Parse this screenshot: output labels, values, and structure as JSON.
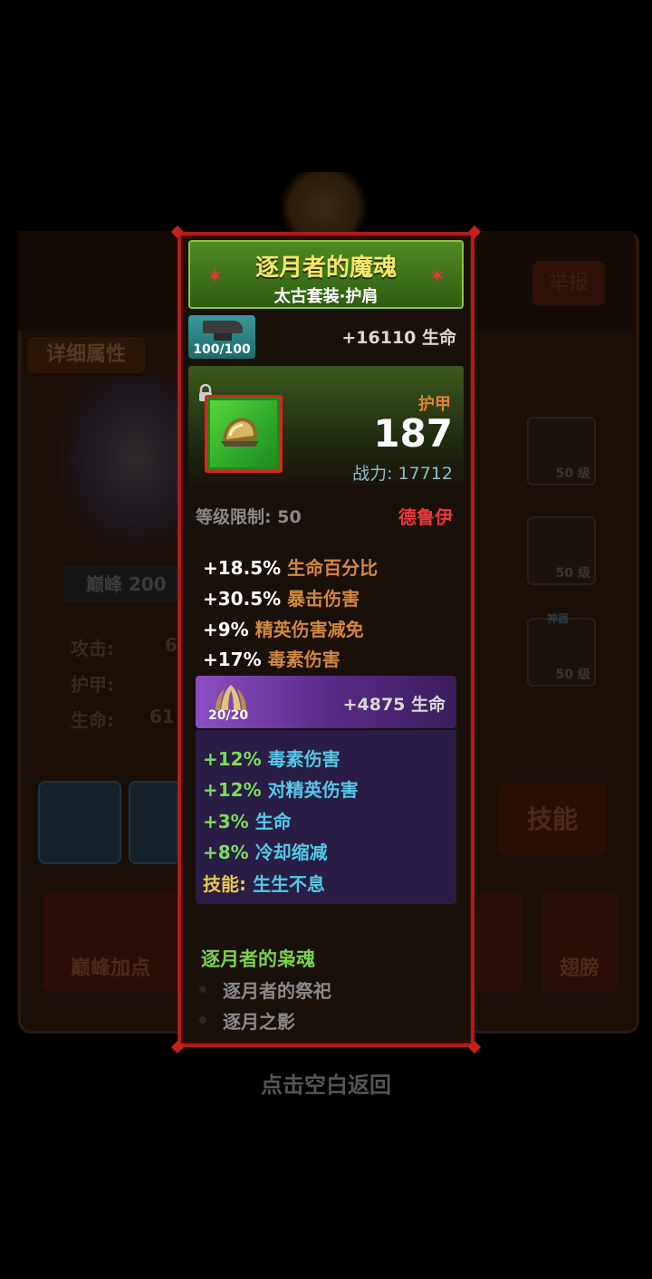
{
  "background": {
    "detail_tab": "详细属性",
    "peak_badge": "巅峰 200",
    "stat_labels": [
      "攻击:",
      "护甲:",
      "生命:"
    ],
    "stat_values": [
      "6",
      "",
      "61"
    ],
    "slot_level": "50 级",
    "slot_tag": "神器",
    "skill_button": "技能",
    "peak_points_button": "巅峰加点",
    "wings_button": "翅膀",
    "top_right_button": "举报"
  },
  "tap_hint": "点击空白返回",
  "item": {
    "name": "逐月者的魔魂",
    "set_slot": "太古套装·护肩",
    "forge_count": "100/100",
    "forge_bonus": "+16110 生命",
    "armor_label": "护甲",
    "armor_value": "187",
    "power_label": "战力:",
    "power_value": "17712",
    "level_label": "等级限制:",
    "level_value": "50",
    "class": "德鲁伊",
    "stats": [
      {
        "value": "+18.5%",
        "name": "生命百分比"
      },
      {
        "value": "+30.5%",
        "name": "暴击伤害"
      },
      {
        "value": "+9%",
        "name": "精英伤害减免"
      },
      {
        "value": "+17%",
        "name": "毒素伤害"
      }
    ],
    "rune": {
      "count": "20/20",
      "bonus": "+4875 生命",
      "stats": [
        {
          "value": "+12%",
          "name": "毒素伤害"
        },
        {
          "value": "+12%",
          "name": "对精英伤害"
        },
        {
          "value": "+3%",
          "name": "生命"
        },
        {
          "value": "+8%",
          "name": "冷却缩减"
        },
        {
          "value": "技能:",
          "name": "生生不息"
        }
      ]
    },
    "set": {
      "title": "逐月者的枭魂",
      "pieces": [
        "逐月者的祭祀",
        "逐月之影"
      ]
    }
  },
  "colors": {
    "frame": "#b01c1c",
    "title_gold": "#f7e66a",
    "stat_tan": "#d2883e",
    "stat_cyan": "#52c9e6",
    "class_red": "#e83a3a",
    "set_green": "#7bd14e"
  }
}
